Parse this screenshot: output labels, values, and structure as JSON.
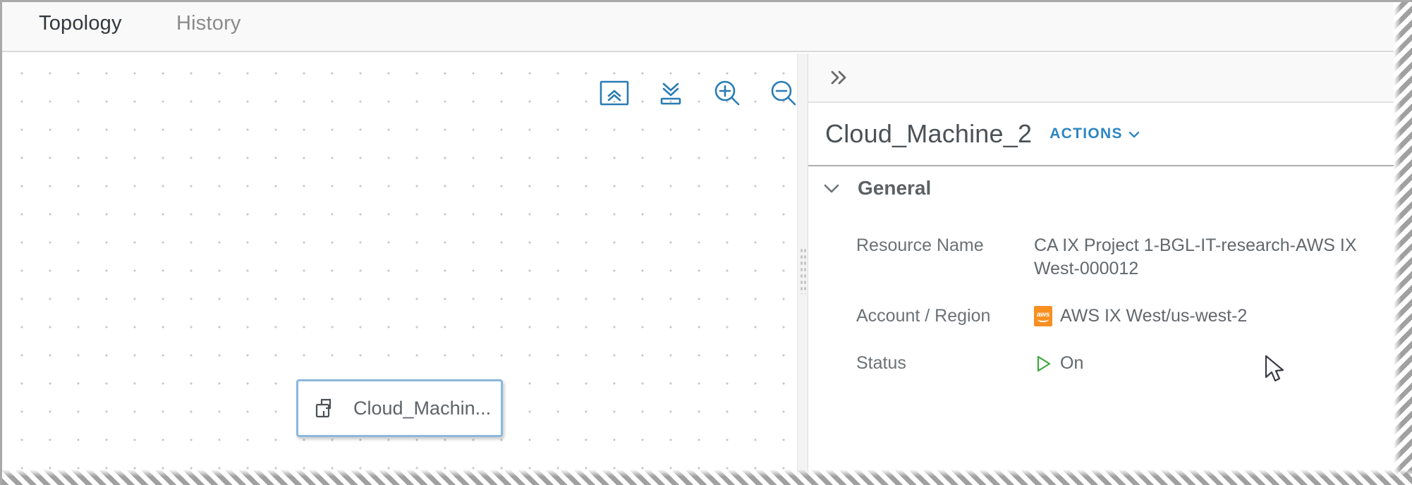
{
  "tabs": [
    {
      "label": "Topology",
      "active": true
    },
    {
      "label": "History",
      "active": false
    }
  ],
  "canvas": {
    "toolbar": [
      {
        "name": "fit-to-screen",
        "title": "Fit to screen"
      },
      {
        "name": "collapse-all",
        "title": "Collapse all"
      },
      {
        "name": "zoom-in",
        "title": "Zoom in"
      },
      {
        "name": "zoom-out",
        "title": "Zoom out"
      }
    ],
    "node": {
      "label": "Cloud_Machin...",
      "icon": "cloud-machine-icon"
    }
  },
  "panel": {
    "collapse_icon": "double-chevron-right-icon",
    "title": "Cloud_Machine_2",
    "actions_label": "ACTIONS",
    "actions_caret": "chevron-down-icon",
    "section": {
      "title": "General",
      "expanded": true,
      "properties": [
        {
          "label": "Resource Name",
          "value": "CA IX Project 1-BGL-IT-research-AWS IX West-000012",
          "icon": null
        },
        {
          "label": "Account / Region",
          "value": "AWS IX West/us-west-2",
          "icon": "aws-logo-icon",
          "icon_text": "aws"
        },
        {
          "label": "Status",
          "value": "On",
          "icon": "status-on-play-icon"
        }
      ]
    }
  },
  "colors": {
    "accent_blue": "#1a7ec2",
    "link_blue": "#2e86c1",
    "tool_blue": "#2a7cb5",
    "aws_orange": "#f79021",
    "status_green": "#3fa63f",
    "text_gray": "#63686d",
    "node_border": "#8cb8dd"
  }
}
